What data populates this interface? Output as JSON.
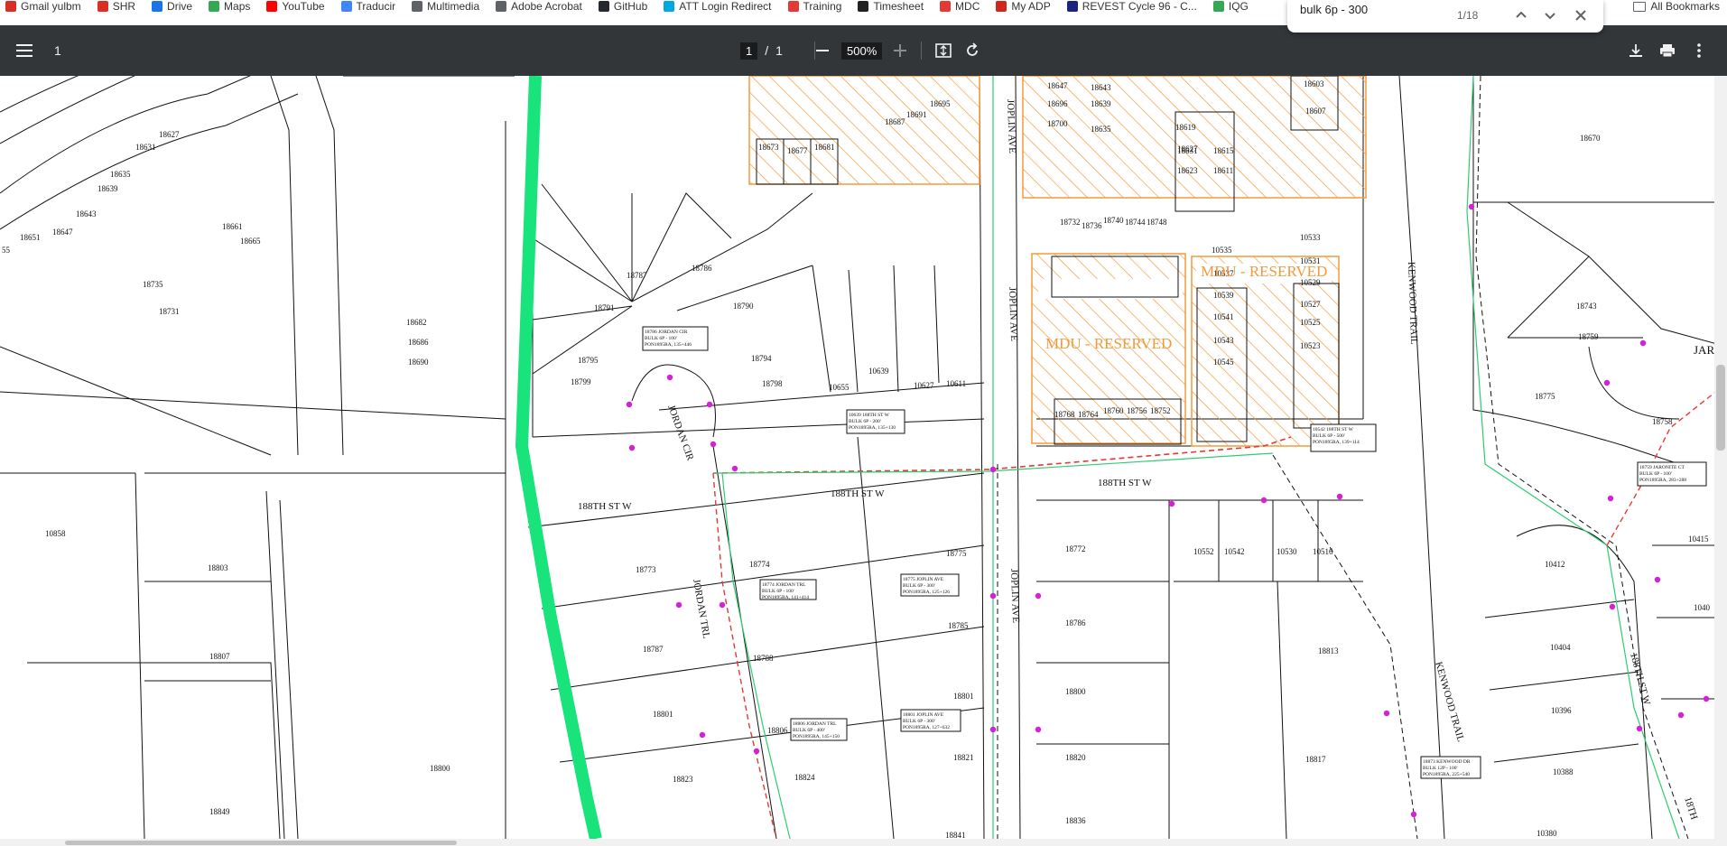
{
  "bookmarks": {
    "items": [
      {
        "label": "Gmail yulbm",
        "icon": "gmail-icon",
        "color": "#d93025"
      },
      {
        "label": "SHR",
        "icon": "gmail-icon",
        "color": "#d93025"
      },
      {
        "label": "Drive",
        "icon": "drive-icon",
        "color": "#1a73e8"
      },
      {
        "label": "Maps",
        "icon": "maps-icon",
        "color": "#34a853"
      },
      {
        "label": "YouTube",
        "icon": "youtube-icon",
        "color": "#ff0000"
      },
      {
        "label": "Traducir",
        "icon": "translate-icon",
        "color": "#4285f4"
      },
      {
        "label": "Multimedia",
        "icon": "folder-icon",
        "color": "#5f6368"
      },
      {
        "label": "Adobe Acrobat",
        "icon": "globe-icon",
        "color": "#5f6368"
      },
      {
        "label": "GitHub",
        "icon": "github-icon",
        "color": "#24292f"
      },
      {
        "label": "ATT Login Redirect",
        "icon": "att-icon",
        "color": "#00a8e0"
      },
      {
        "label": "Training",
        "icon": "training-icon",
        "color": "#e53935"
      },
      {
        "label": "Timesheet",
        "icon": "timesheet-icon",
        "color": "#222222"
      },
      {
        "label": "MDC",
        "icon": "mdc-icon",
        "color": "#e53935"
      },
      {
        "label": "My ADP",
        "icon": "adp-icon",
        "color": "#d0271d"
      },
      {
        "label": "REVEST Cycle 96 - C...",
        "icon": "p-icon",
        "color": "#1a237e"
      },
      {
        "label": "IQG",
        "icon": "iqg-icon",
        "color": "#34a853"
      }
    ],
    "all_bookmarks": "All Bookmarks"
  },
  "find": {
    "query": "bulk 6p - 300",
    "count": "1/18"
  },
  "toolbar": {
    "title": "1",
    "page_current": "1",
    "page_sep": "/",
    "page_total": "1",
    "zoom": "500%"
  },
  "map": {
    "road_labels": [
      "188TH ST W",
      "188TH ST W",
      "188TH ST W",
      "188TH ST W",
      "JORDAN CIR",
      "JORDAN TRL",
      "JOPLIN AVE",
      "JOPLIN AVE",
      "JOPLIN AVE",
      "KENWOOD TRAIL",
      "KENWOOD TRAIL",
      "JARO",
      "18TH"
    ],
    "reserved": [
      "MDU - RESERVED",
      "MDU - RESERVED"
    ],
    "lots": [
      "18627",
      "18631",
      "18635",
      "18639",
      "18643",
      "18647",
      "18651",
      "55",
      "18661",
      "18665",
      "18735",
      "18731",
      "18682",
      "18686",
      "18690",
      "18787",
      "18786",
      "18791",
      "18790",
      "18795",
      "18794",
      "18799",
      "18798",
      "10639",
      "10655",
      "10627",
      "10611",
      "18673",
      "18677",
      "18681",
      "18687",
      "18691",
      "18695",
      "18647",
      "18643",
      "18696",
      "18639",
      "18700",
      "18635",
      "18603",
      "18607",
      "18619",
      "18631",
      "18627",
      "18615",
      "18623",
      "18611",
      "18732",
      "18736",
      "18740",
      "18744",
      "18748",
      "10533",
      "10535",
      "10531",
      "10537",
      "10529",
      "10539",
      "10527",
      "10541",
      "10525",
      "10543",
      "10523",
      "10545",
      "18768",
      "18764",
      "18760",
      "18756",
      "18752",
      "18670",
      "18743",
      "18759",
      "18775",
      "18758",
      "10858",
      "18803",
      "18807",
      "18800",
      "18849",
      "18773",
      "18774",
      "18787",
      "18788",
      "18801",
      "18806",
      "18823",
      "18824",
      "18775",
      "18785",
      "18801",
      "18821",
      "18841",
      "18772",
      "18786",
      "18800",
      "18820",
      "18836",
      "10552",
      "10542",
      "10530",
      "10516",
      "18813",
      "18817",
      "10412",
      "10404",
      "10396",
      "10388",
      "10380",
      "10415",
      "1040"
    ],
    "callouts": [
      "18786 JORDAN CIR\nBULK 6P - 100'\nPON1895RA, 135+446",
      "10639 188TH ST W\nBULK 6P - 200'\nPON1895RA, 135+130",
      "10542 188TH ST W\nBULK 6P - 500'\nPON1895RA, 139+114",
      "18774 JORDAN TRL\nBULK 6P - 100'\nPON1895RA, 141+414",
      "18775 JOPLIN AVE\nBULK 6P - 300'\nPON1895RA, 125+126",
      "18806 JORDAN TRL\nBULK 6P - 400'\nPON1895RA, 145+150",
      "18801 JOPLIN AVE\nBULK 6P - 300'\nPON1895RA, 127+632",
      "18759 JARONITE CT\nBULK 6P - 100'\nPON1895RA, 283+288",
      "18873 KENWOOD DR\nBULK 12P - 100'\nPON1895RA, 225+540"
    ]
  },
  "colors": {
    "toolbar_bg": "#323639",
    "green_corridor": "#19e37b",
    "orange_hatch": "#f39a3c",
    "magenta_marker": "#d81fd8",
    "red_route": "#e53935",
    "green_route": "#2ecc71"
  }
}
